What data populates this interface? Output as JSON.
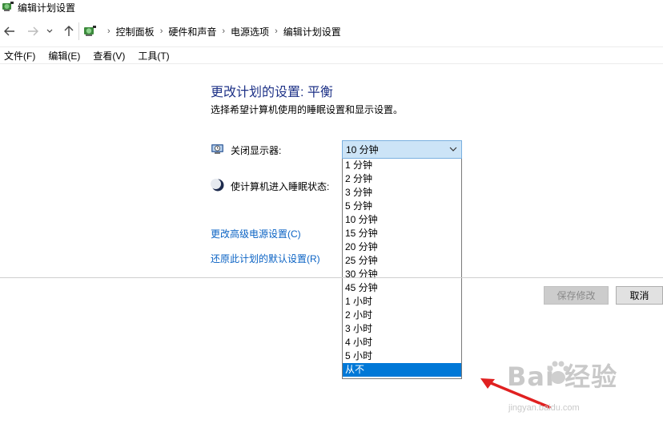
{
  "window": {
    "title": "编辑计划设置"
  },
  "address_bar": {
    "breadcrumbs": [
      "控制面板",
      "硬件和声音",
      "电源选项",
      "编辑计划设置"
    ]
  },
  "menu": [
    "文件(F)",
    "编辑(E)",
    "查看(V)",
    "工具(T)"
  ],
  "main": {
    "heading": "更改计划的设置: 平衡",
    "subtitle": "选择希望计算机使用的睡眠设置和显示设置。",
    "display_off": {
      "label": "关闭显示器:",
      "selected": "10 分钟"
    },
    "sleep": {
      "label": "使计算机进入睡眠状态:"
    },
    "dropdown_options": [
      "1 分钟",
      "2 分钟",
      "3 分钟",
      "5 分钟",
      "10 分钟",
      "15 分钟",
      "20 分钟",
      "25 分钟",
      "30 分钟",
      "45 分钟",
      "1 小时",
      "2 小时",
      "3 小时",
      "4 小时",
      "5 小时",
      "从不"
    ],
    "highlighted_option": "从不",
    "links": {
      "advanced": "更改高级电源设置(C)",
      "restore": "还原此计划的默认设置(R)"
    }
  },
  "buttons": {
    "save": "保存修改",
    "cancel": "取消"
  },
  "annotation": {
    "arrow_color": "#e02020"
  },
  "watermark": {
    "main": "Bai  经验",
    "sub": "jingyan.baidu.com"
  },
  "colors": {
    "heading": "#1e3287",
    "link": "#0b63c4",
    "selection": "#0078d7",
    "combo_bg": "#cce4f7"
  }
}
